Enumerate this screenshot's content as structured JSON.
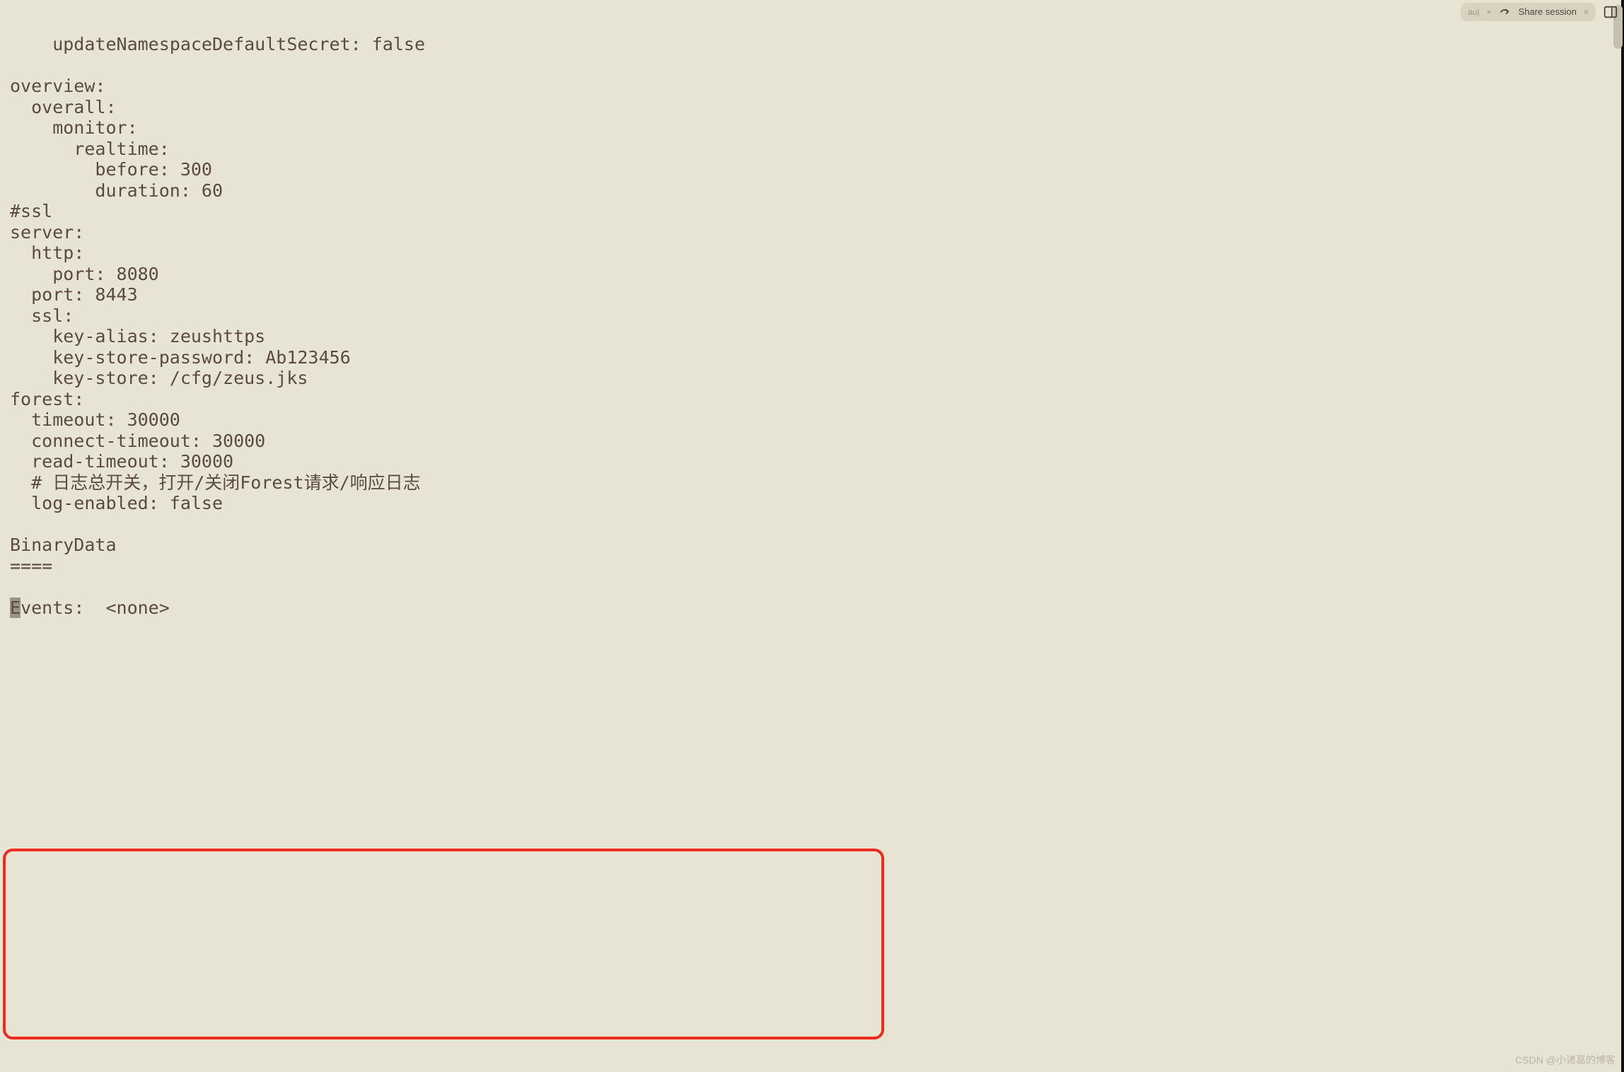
{
  "toolbar": {
    "hint": "au|",
    "share_label": "Share session"
  },
  "code": {
    "l1": "    updateNamespaceDefaultSecret: false",
    "l2": "",
    "l3": "overview:",
    "l4": "  overall:",
    "l5": "    monitor:",
    "l6": "      realtime:",
    "l7": "        before: 300",
    "l8": "        duration: 60",
    "l9": "#ssl",
    "l10": "server:",
    "l11": "  http:",
    "l12": "    port: 8080",
    "l13": "  port: 8443",
    "l14": "  ssl:",
    "l15": "    key-alias: zeushttps",
    "l16": "    key-store-password: Ab123456",
    "l17": "    key-store: /cfg/zeus.jks",
    "l18": "forest:",
    "l19": "  timeout: 30000",
    "l20": "  connect-timeout: 30000",
    "l21": "  read-timeout: 30000",
    "l22": "  # 日志总开关，打开/关闭Forest请求/响应日志",
    "l23": "  log-enabled: false",
    "l24": "",
    "l25": "BinaryData",
    "l26": "====",
    "l27": "",
    "l28_cursor": "E",
    "l28_rest": "vents:  <none>"
  },
  "watermark": "CSDN @小诸葛的博客"
}
